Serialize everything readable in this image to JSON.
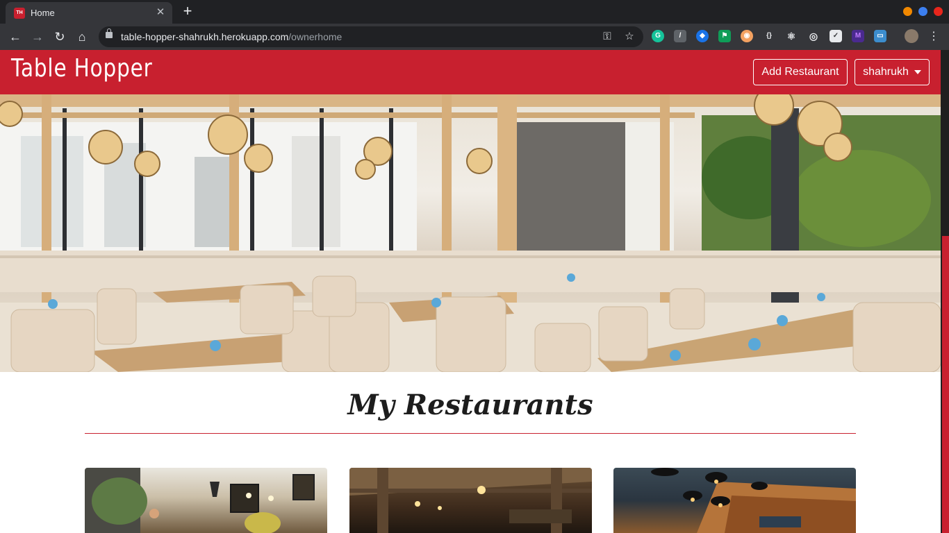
{
  "browser": {
    "tab": {
      "title": "Home",
      "favicon_text": "TH"
    },
    "url": {
      "host": "table-hopper-shahrukh.herokuapp.com",
      "path": "/ownerhome"
    }
  },
  "navbar": {
    "brand": "Table Hopper",
    "add_restaurant": "Add Restaurant",
    "user_menu": "shahrukh"
  },
  "main": {
    "heading": "My Restaurants",
    "cards": [
      {
        "image": "restaurant-photo-1"
      },
      {
        "image": "restaurant-photo-2"
      },
      {
        "image": "restaurant-photo-3"
      }
    ]
  },
  "colors": {
    "brand_red": "#c8202f",
    "chrome_dark": "#202124",
    "chrome_toolbar": "#35363a"
  },
  "icons": {
    "back": "arrow-left-icon",
    "forward": "arrow-right-icon",
    "reload": "reload-icon",
    "home": "home-icon",
    "lock": "lock-icon",
    "key": "key-icon",
    "star": "star-icon"
  }
}
